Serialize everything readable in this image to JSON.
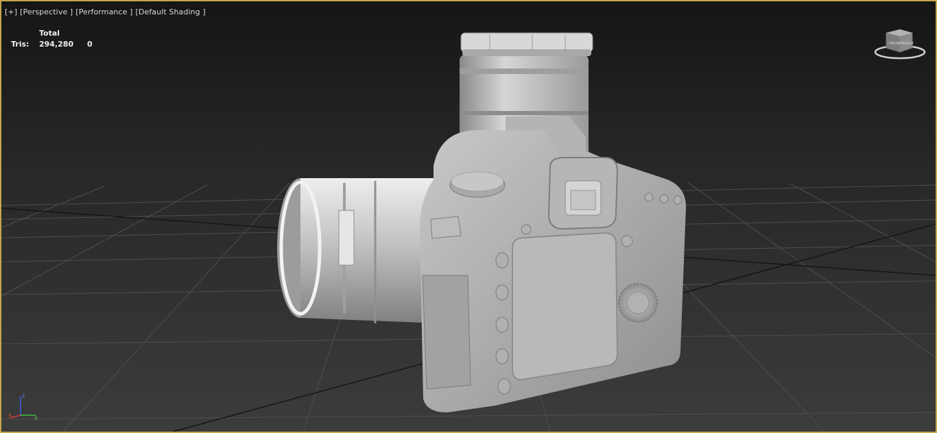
{
  "viewport": {
    "menu": {
      "plus": "[+]",
      "view": "[Perspective ]",
      "mode": "[Performance ]",
      "shading": "[Default Shading ]"
    },
    "stats": {
      "header": "Total",
      "label": "Tris:",
      "total": "294,280",
      "selected": "0"
    },
    "viewcube": {
      "left_face": "FRONT",
      "right_face": "RIGHT"
    },
    "axis_labels": {
      "x": "x",
      "y": "y",
      "z": "z"
    },
    "colors": {
      "active_border": "#c9a64a",
      "axis_x": "#d04030",
      "axis_y": "#40c040",
      "axis_z": "#4060e0"
    }
  }
}
